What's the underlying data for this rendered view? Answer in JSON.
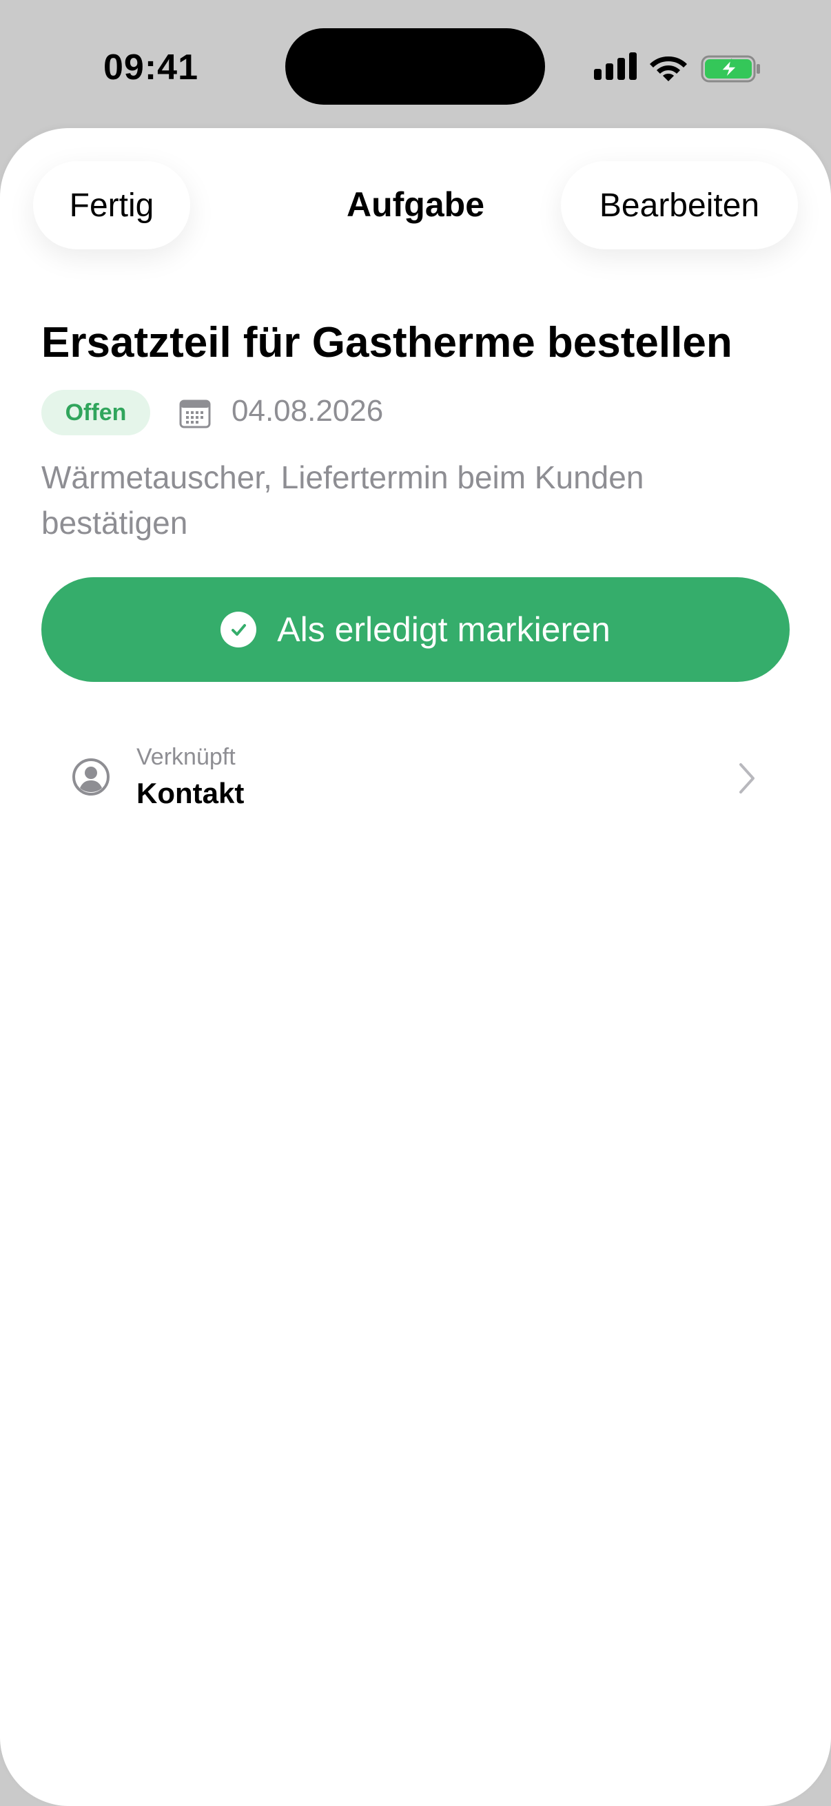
{
  "status_bar": {
    "time": "09:41"
  },
  "nav": {
    "done_label": "Fertig",
    "title": "Aufgabe",
    "edit_label": "Bearbeiten"
  },
  "task": {
    "title": "Ersatzteil für Gastherme bestellen",
    "status": "Offen",
    "due_date": "04.08.2026",
    "description": "Wärmetauscher, Liefertermin beim Kunden bestätigen",
    "complete_button_label": "Als erledigt markieren"
  },
  "linked": {
    "label": "Verknüpft",
    "value": "Kontakt"
  },
  "colors": {
    "accent_green": "#35ad6b",
    "status_badge_bg": "#e5f5ea",
    "status_badge_text": "#30a55c",
    "secondary_text": "#8e8e93"
  },
  "icons": {
    "calendar": "calendar-icon",
    "check": "checkmark-circle-icon",
    "linked": "person-circle-icon",
    "chevron": "chevron-right-icon"
  }
}
